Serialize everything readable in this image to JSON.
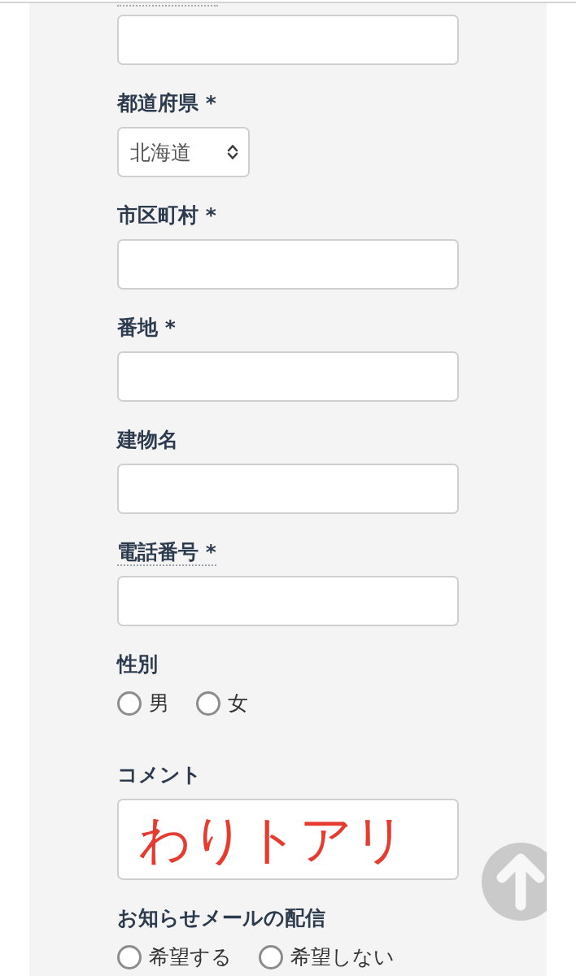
{
  "form": {
    "fields": [
      {
        "kind": "text",
        "dotted_underline": true
      },
      {
        "kind": "select",
        "label": "都道府県 *",
        "value": "北海道",
        "dotted_underline": false
      },
      {
        "kind": "text",
        "label": "市区町村 *",
        "dotted_underline": false
      },
      {
        "kind": "text",
        "label": "番地 *",
        "dotted_underline": false
      },
      {
        "kind": "text",
        "label": "建物名",
        "dotted_underline": false
      },
      {
        "kind": "text",
        "label": "電話番号 *",
        "dotted_underline": true
      },
      {
        "kind": "radio",
        "label": "性別",
        "dotted_underline": false,
        "options": [
          {
            "label": "男",
            "selected": false
          },
          {
            "label": "女",
            "selected": false
          }
        ]
      },
      {
        "kind": "textarea",
        "label": "コメント",
        "value": "わりトアリ",
        "dotted_underline": false
      },
      {
        "kind": "radio",
        "label": "お知らせメールの配信",
        "dotted_underline": false,
        "options": [
          {
            "label": "希望する",
            "selected": false
          },
          {
            "label": "希望しない",
            "selected": false
          }
        ]
      }
    ]
  }
}
